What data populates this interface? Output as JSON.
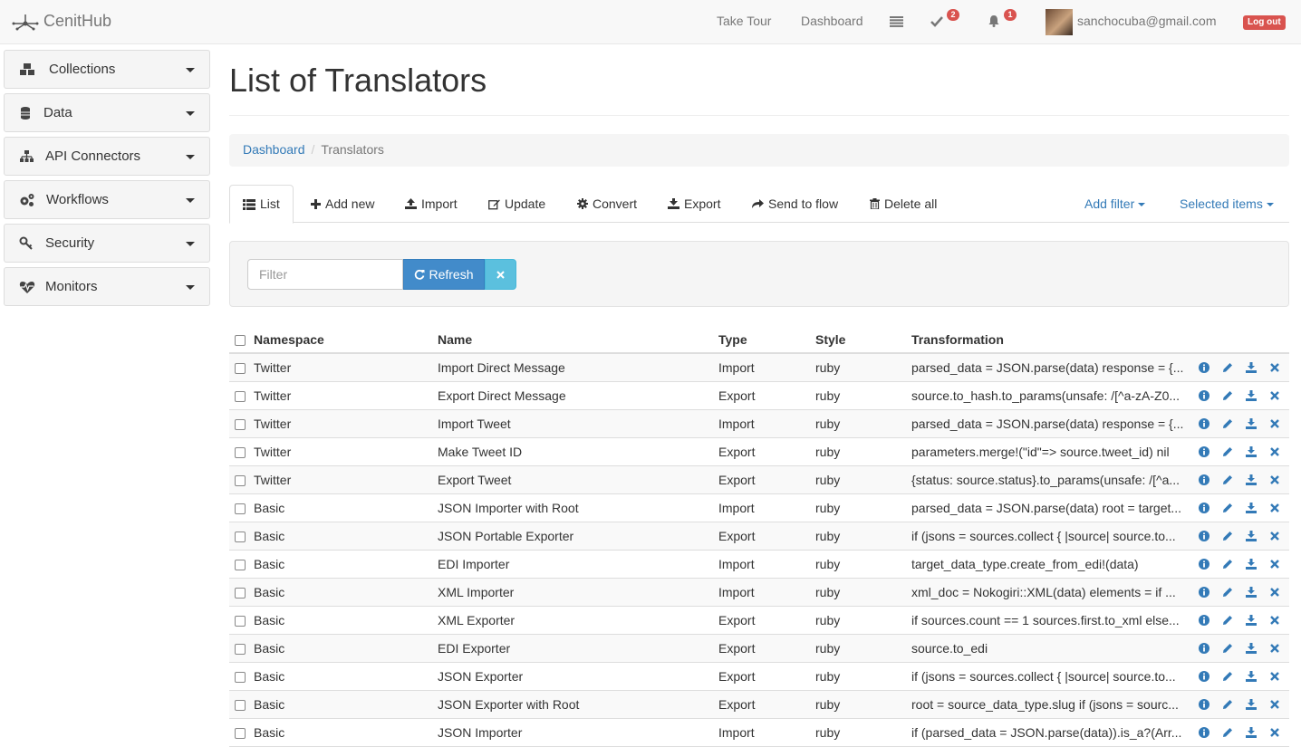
{
  "brand": {
    "name": "CenitHub"
  },
  "navbar": {
    "take_tour": "Take Tour",
    "dashboard": "Dashboard",
    "tasks_badge": "2",
    "notifications_badge": "1",
    "user_email": "sanchocuba@gmail.com",
    "logout": "Log out"
  },
  "sidebar": {
    "items": [
      {
        "label": "Collections",
        "icon": "cubes-icon"
      },
      {
        "label": "Data",
        "icon": "database-icon"
      },
      {
        "label": "API Connectors",
        "icon": "sitemap-icon"
      },
      {
        "label": "Workflows",
        "icon": "cogs-icon"
      },
      {
        "label": "Security",
        "icon": "key-icon"
      },
      {
        "label": "Monitors",
        "icon": "heartbeat-icon"
      }
    ]
  },
  "page": {
    "title": "List of Translators"
  },
  "breadcrumb": {
    "home": "Dashboard",
    "current": "Translators"
  },
  "tabs": {
    "list": "List",
    "add_new": "Add new",
    "import": "Import",
    "update": "Update",
    "convert": "Convert",
    "export": "Export",
    "send_to_flow": "Send to flow",
    "delete_all": "Delete all",
    "add_filter": "Add filter",
    "selected_items": "Selected items"
  },
  "filter": {
    "placeholder": "Filter",
    "refresh": "Refresh"
  },
  "table": {
    "headers": {
      "namespace": "Namespace",
      "name": "Name",
      "type": "Type",
      "style": "Style",
      "transformation": "Transformation"
    },
    "rows": [
      {
        "namespace": "Twitter",
        "name": "Import Direct Message",
        "type": "Import",
        "style": "ruby",
        "transformation": "parsed_data = JSON.parse(data) response = {..."
      },
      {
        "namespace": "Twitter",
        "name": "Export Direct Message",
        "type": "Export",
        "style": "ruby",
        "transformation": "source.to_hash.to_params(unsafe: /[^a-zA-Z0..."
      },
      {
        "namespace": "Twitter",
        "name": "Import Tweet",
        "type": "Import",
        "style": "ruby",
        "transformation": "parsed_data = JSON.parse(data) response = {..."
      },
      {
        "namespace": "Twitter",
        "name": "Make Tweet ID",
        "type": "Export",
        "style": "ruby",
        "transformation": "parameters.merge!(\"id\"=> source.tweet_id) nil"
      },
      {
        "namespace": "Twitter",
        "name": "Export Tweet",
        "type": "Export",
        "style": "ruby",
        "transformation": "{status: source.status}.to_params(unsafe: /[^a..."
      },
      {
        "namespace": "Basic",
        "name": "JSON Importer with Root",
        "type": "Import",
        "style": "ruby",
        "transformation": "parsed_data = JSON.parse(data) root = target..."
      },
      {
        "namespace": "Basic",
        "name": "JSON Portable Exporter",
        "type": "Export",
        "style": "ruby",
        "transformation": "if (jsons = sources.collect { |source| source.to..."
      },
      {
        "namespace": "Basic",
        "name": "EDI Importer",
        "type": "Import",
        "style": "ruby",
        "transformation": "target_data_type.create_from_edi!(data)"
      },
      {
        "namespace": "Basic",
        "name": "XML Importer",
        "type": "Import",
        "style": "ruby",
        "transformation": "xml_doc = Nokogiri::XML(data) elements = if ..."
      },
      {
        "namespace": "Basic",
        "name": "XML Exporter",
        "type": "Export",
        "style": "ruby",
        "transformation": "if sources.count == 1 sources.first.to_xml else..."
      },
      {
        "namespace": "Basic",
        "name": "EDI Exporter",
        "type": "Export",
        "style": "ruby",
        "transformation": "source.to_edi"
      },
      {
        "namespace": "Basic",
        "name": "JSON Exporter",
        "type": "Export",
        "style": "ruby",
        "transformation": "if (jsons = sources.collect { |source| source.to..."
      },
      {
        "namespace": "Basic",
        "name": "JSON Exporter with Root",
        "type": "Export",
        "style": "ruby",
        "transformation": "root = source_data_type.slug if (jsons = sourc..."
      },
      {
        "namespace": "Basic",
        "name": "JSON Importer",
        "type": "Import",
        "style": "ruby",
        "transformation": "if (parsed_data = JSON.parse(data)).is_a?(Arr..."
      }
    ]
  },
  "colors": {
    "link": "#337ab7",
    "danger": "#d9534f",
    "primary": "#428bca",
    "info": "#5bc0de"
  }
}
